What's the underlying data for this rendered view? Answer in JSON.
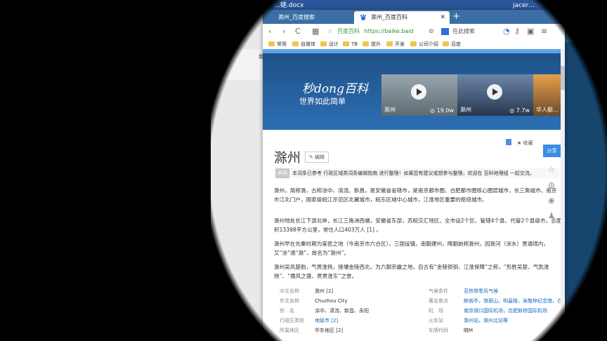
{
  "word": {
    "doc_title": "…链.docx",
    "user": "jacer…",
    "ribbon_label": "我"
  },
  "browser": {
    "tabs": [
      {
        "label": "滁州_百度搜索",
        "active": false
      },
      {
        "label": "滁州_百度百科",
        "active": true
      }
    ],
    "new_tab": "+",
    "nav": {
      "back": "‹",
      "forward": "›",
      "reload": "C"
    },
    "address": {
      "site_name": "百度百科",
      "url": "https://baike.baid"
    },
    "search_placeholder": "在此搜索",
    "bookmarks": [
      "常用",
      "自媒体",
      "设计",
      "TB",
      "提升",
      "开发",
      "公司介绍",
      "百度"
    ]
  },
  "page": {
    "logo": "秒dong百科",
    "slogan": "世界如此简单",
    "videos": [
      {
        "caption": "滁州",
        "views": "19.0w"
      },
      {
        "caption": "滁州",
        "views": "7.7w"
      },
      {
        "caption": "华人额…",
        "views": ""
      }
    ],
    "collect": "收藏",
    "title": "滁州",
    "edit": "编辑",
    "notice_tag": "声明",
    "notice_text": "本词条已参考 行政区域类词条编辑指南 进行整理！如果您有建议或想参与整理，欢迎在 百科地理组 一起交流。",
    "paragraphs": [
      "滁州，简称滁，古称涂中、清流、新昌，是安徽省省辖市，是南京都市圈、合肥都市圈核心圈层城市、长三角城市、南京市江北门户，国家级皖江示范区北翼城市，皖东区域中心城市，江淮地区重要的枢纽城市。",
      "滁州地处长江下游北岸，长江三角洲西端，安徽省东部，苏皖交汇地区。全市设2个区、管辖4个县、代管2个县级市，总面积13398平方公里，常住人口403万人 [1] 。",
      "滁州早在先秦时期为棠邑之地（今南京市六合区），三国设镇，南朝建州，隋朝始称滁州，因滁河（涂水）贯通境内，又“涂”通“滁”，故名为“滁州”。",
      "滁州吴风楚韵，气贯淮扬，接壤金陵西北，为六朝京畿之地，自古有“金陵锁钥、江淮保障”之称，“形胜吴楚、气凯淮扬”、“儒风之盛、贯贯淮东”之誉。"
    ],
    "infobox": [
      {
        "k": "中文名称",
        "v": "滁州 [2]"
      },
      {
        "k": "气候条件",
        "v": "亚热带季风气候"
      },
      {
        "k": "外文名称",
        "v": "Chuzhou City"
      },
      {
        "k": "著名景点",
        "v": "醉翁亭，琅琊山，明皇陵，吴敬梓纪念馆，白蜡"
      },
      {
        "k": "别　名",
        "v": "涂中、清流、新昌、永阳"
      },
      {
        "k": "机　场",
        "v": "南京禄口国际机场，合肥新桥国际机场"
      },
      {
        "k": "行政区类别",
        "v": "地级市 [2]"
      },
      {
        "k": "火车站",
        "v": "滁州站，滁州北站等"
      },
      {
        "k": "所属地区",
        "v": "华东地区 [2]"
      },
      {
        "k": "车牌代码",
        "v": "皖M"
      }
    ],
    "share": "分享"
  },
  "colors": {
    "accent": "#3a8ee6",
    "link": "#136ec2",
    "tabbar": "#3a6ea5"
  }
}
